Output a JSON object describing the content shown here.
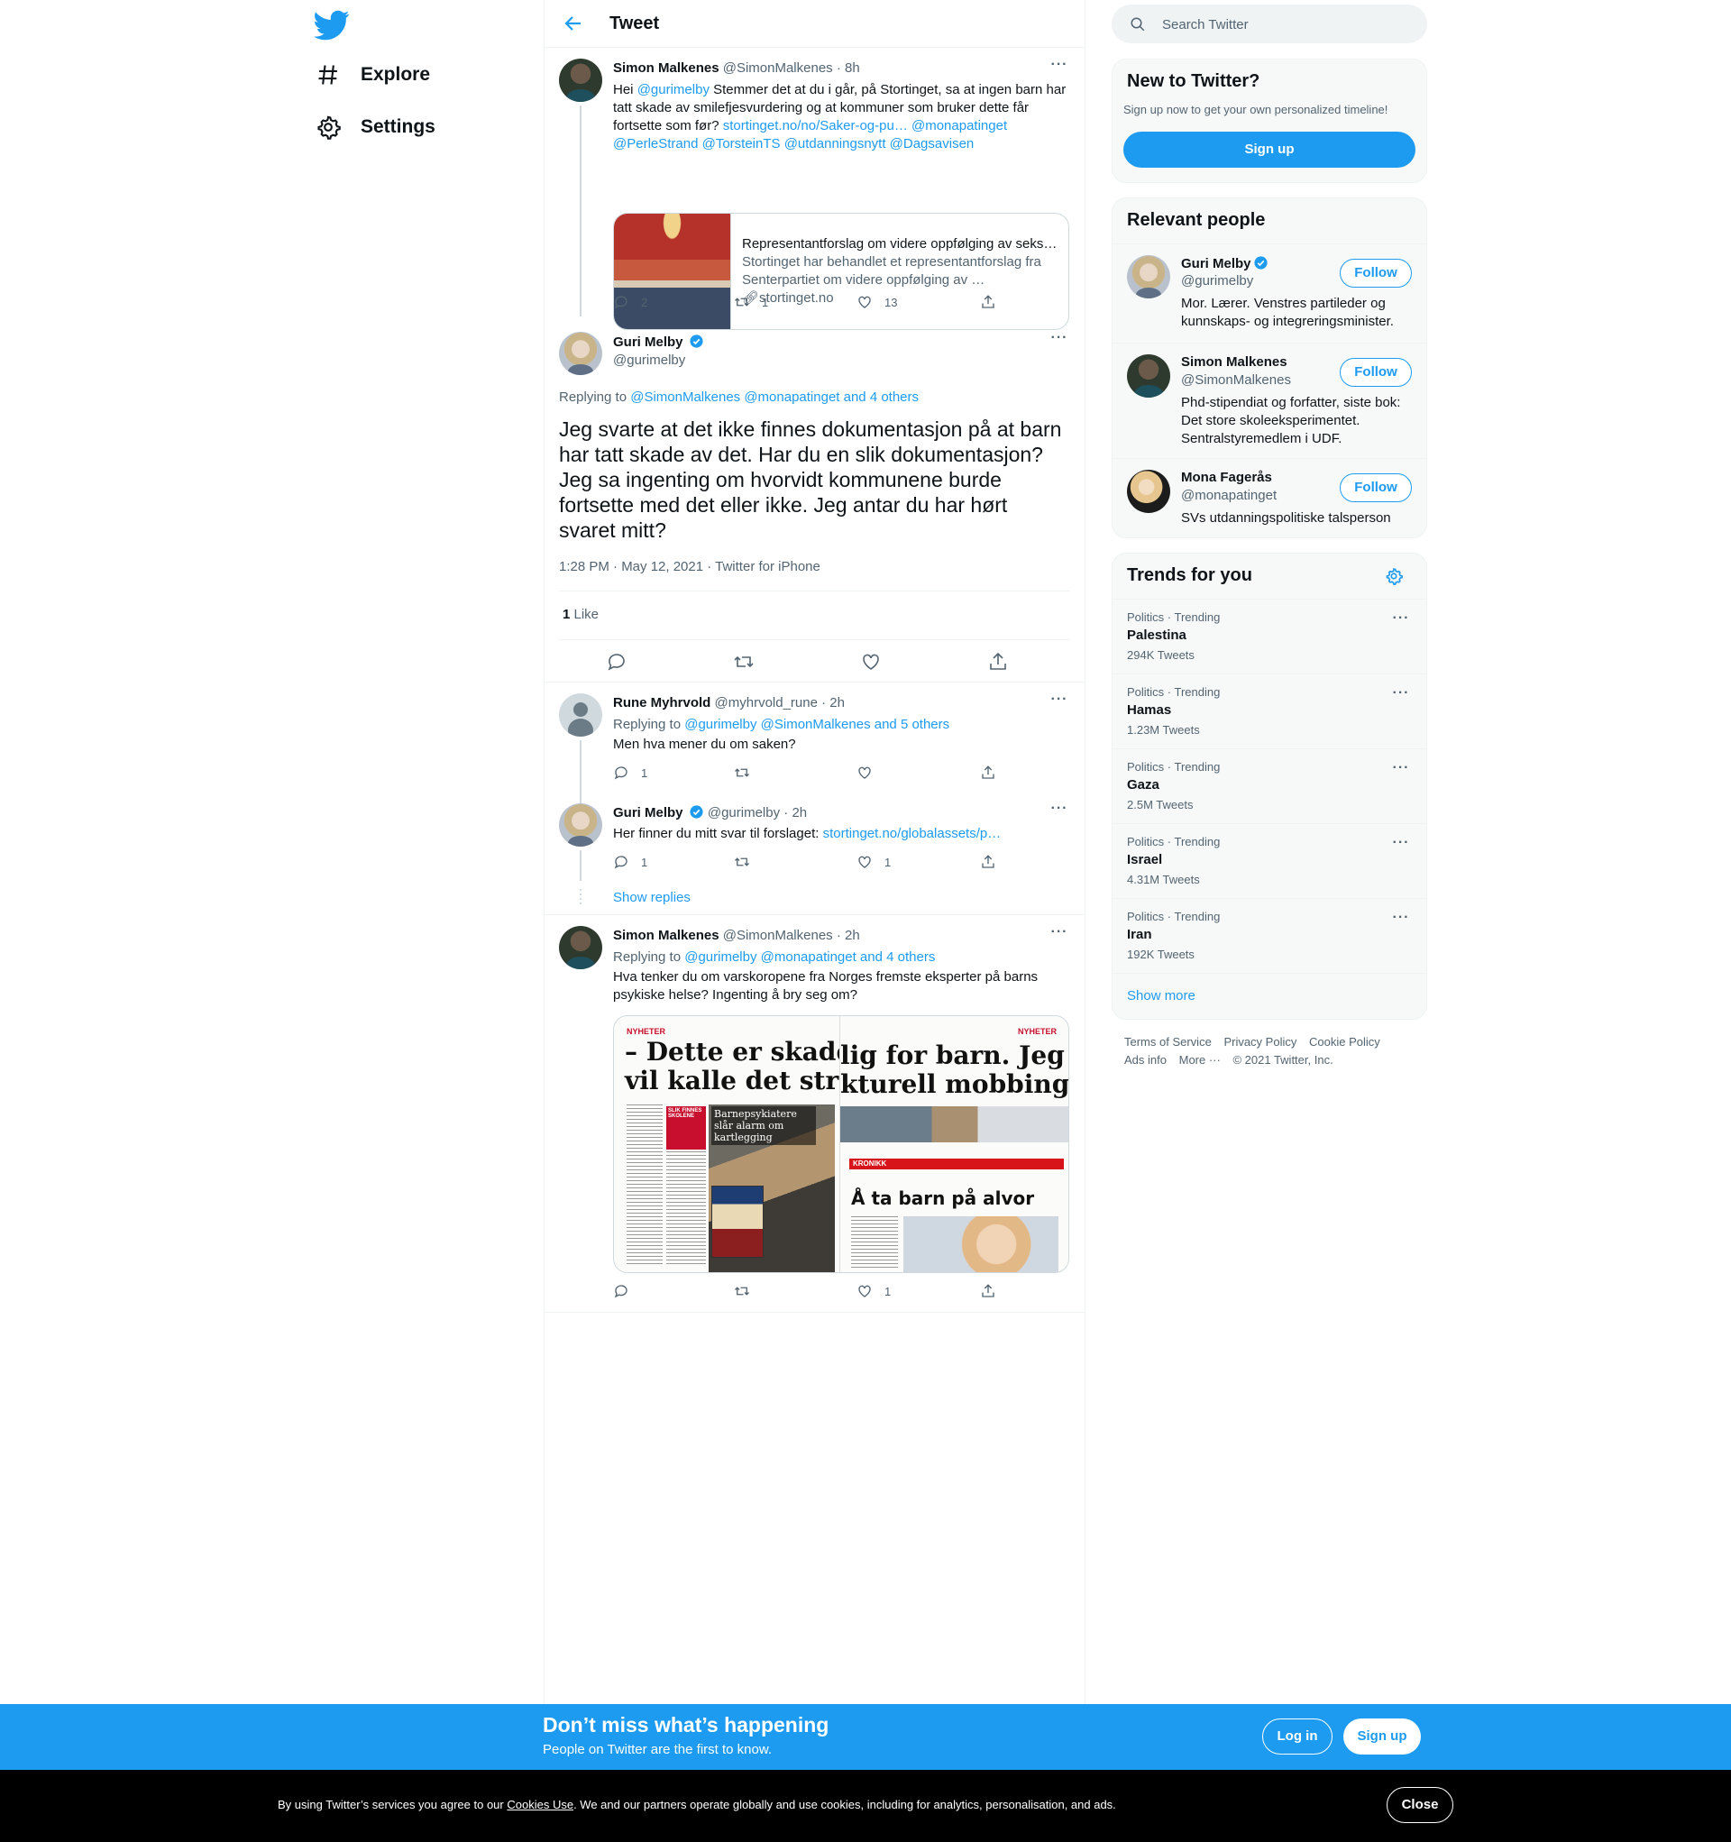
{
  "nav": {
    "explore_label": "Explore",
    "settings_label": "Settings"
  },
  "header": {
    "title": "Tweet"
  },
  "parent_tweet": {
    "name": "Simon Malkenes",
    "handle": "@SimonMalkenes",
    "time": "· 8h",
    "text_pre": "Hei ",
    "mention1": "@gurimelby",
    "text_mid": " Stemmer det at du i går, på Stortinget, sa at ingen barn har tatt skade av smilefjesvurdering og at kommuner som bruker dette får fortsette som før? ",
    "link": "stortinget.no/no/Saker-og-pu…",
    "mentions_tail": " @monapatinget @PerleStrand @TorsteinTS @utdanningsnytt @Dagsavisen",
    "card": {
      "title": "Representantforslag om videre oppfølging av seks…",
      "description": "Stortinget har behandlet et representantforslag fra Senterpartiet om videre oppfølging av …",
      "domain": "stortinget.no"
    },
    "replies": "2",
    "retweets": "1",
    "likes": "13"
  },
  "focus_tweet": {
    "name": "Guri Melby",
    "handle": "@gurimelby",
    "replying_prefix": "Replying to ",
    "replying_to": "@SimonMalkenes @monapatinget and 4 others",
    "text": "Jeg svarte at det ikke finnes dokumentasjon på at barn har tatt skade av det. Har du en slik dokumentasjon? Jeg sa ingenting om hvorvidt kommunene burde fortsette med det eller ikke. Jeg antar du har hørt svaret mitt?",
    "timestamp": "1:28 PM · May 12, 2021 · Twitter for iPhone",
    "like_count": "1",
    "like_label": " Like"
  },
  "reply1": {
    "name": "Rune Myhrvold",
    "handle": "@myhrvold_rune",
    "time": "· 2h",
    "replying_prefix": "Replying to ",
    "replying_to": "@gurimelby @SimonMalkenes and 5 others",
    "text": "Men hva mener du om saken?",
    "replies": "1"
  },
  "reply2": {
    "name": "Guri Melby",
    "handle": "@gurimelby",
    "time": "· 2h",
    "text": "Her finner du mitt svar til forslaget: ",
    "link": "stortinget.no/globalassets/p…",
    "replies": "1",
    "likes": "1"
  },
  "show_replies": "Show replies",
  "reply3": {
    "name": "Simon Malkenes",
    "handle": "@SimonMalkenes",
    "time": "· 2h",
    "replying_prefix": "Replying to ",
    "replying_to": "@gurimelby @monapatinget and 4 others",
    "text": "Hva tenker du om varskoropene fra Norges fremste eksperter på barns psykiske helse? Ingenting å bry seg om?",
    "likes": "1",
    "image": {
      "tag_left": "NYHETER",
      "tag_right": "NYHETER",
      "headline_left_1": "– Dette er skade",
      "headline_left_2": "vil kalle det stru",
      "headline_right_1": "lig for barn. Jeg",
      "headline_right_2": "kturell mobbing.",
      "subhead": "Barnepsykiatere slår alarm om kartlegging",
      "badge": "SLIK FINNES SKOLENE",
      "kronikk": "KRONIKK",
      "headline_kronikk": "Å ta barn på alvor"
    }
  },
  "search": {
    "placeholder": "Search Twitter"
  },
  "new_to_twitter": {
    "title": "New to Twitter?",
    "subtitle": "Sign up now to get your own personalized timeline!",
    "button": "Sign up"
  },
  "relevant_people": {
    "title": "Relevant people",
    "follow_label": "Follow",
    "people": [
      {
        "name": "Guri Melby",
        "handle": "@gurimelby",
        "bio": "Mor. Lærer. Venstres partileder og kunnskaps- og integreringsminister."
      },
      {
        "name": "Simon Malkenes",
        "handle": "@SimonMalkenes",
        "bio": "Phd-stipendiat og forfatter, siste bok: Det store skoleeksperimentet. Sentralstyremedlem i UDF."
      },
      {
        "name": "Mona Fagerås",
        "handle": "@monapatinget",
        "bio": "SVs utdanningspolitiske talsperson"
      }
    ]
  },
  "trends": {
    "title": "Trends for you",
    "items": [
      {
        "category": "Politics · Trending",
        "name": "Palestina",
        "count": "294K Tweets"
      },
      {
        "category": "Politics · Trending",
        "name": "Hamas",
        "count": "1.23M Tweets"
      },
      {
        "category": "Politics · Trending",
        "name": "Gaza",
        "count": "2.5M Tweets"
      },
      {
        "category": "Politics · Trending",
        "name": "Israel",
        "count": "4.31M Tweets"
      },
      {
        "category": "Politics · Trending",
        "name": "Iran",
        "count": "192K Tweets"
      }
    ],
    "show_more": "Show more"
  },
  "footer": {
    "terms": "Terms of Service",
    "privacy": "Privacy Policy",
    "cookie": "Cookie Policy",
    "ads": "Ads info",
    "more": "More ···",
    "copyright": "© 2021 Twitter, Inc."
  },
  "banner": {
    "title": "Don’t miss what’s happening",
    "subtitle": "People on Twitter are the first to know.",
    "login": "Log in",
    "signup": "Sign up"
  },
  "cookie_bar": {
    "text_pre": "By using Twitter’s services you agree to our ",
    "link": "Cookies Use",
    "text_post": ". We and our partners operate globally and use cookies, including for analytics, personalisation, and ads.",
    "close": "Close"
  },
  "colors": {
    "accent": "#1d9bf0",
    "text": "#0f1419",
    "secondary": "#536471",
    "border": "#eff3f4"
  }
}
